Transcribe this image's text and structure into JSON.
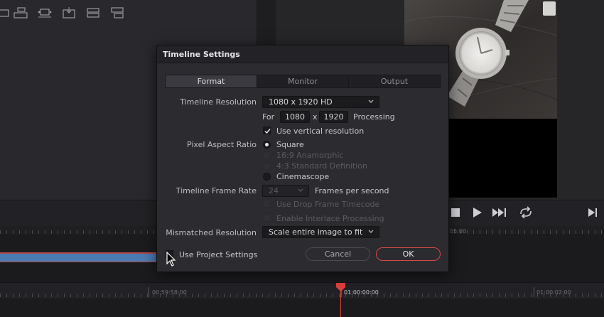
{
  "dialog": {
    "title": "Timeline Settings",
    "tabs": [
      "Format",
      "Monitor",
      "Output"
    ],
    "active_tab": "Format",
    "resolution": {
      "label": "Timeline Resolution",
      "value": "1080 x 1920 HD",
      "for_label": "For",
      "width": "1080",
      "x_label": "x",
      "height": "1920",
      "processing_label": "Processing",
      "vertical_label": "Use vertical resolution",
      "vertical_checked": true
    },
    "pixel_aspect": {
      "label": "Pixel Aspect Ratio",
      "options": [
        {
          "label": "Square",
          "selected": true,
          "enabled": true
        },
        {
          "label": "16:9 Anamorphic",
          "selected": false,
          "enabled": false
        },
        {
          "label": "4:3 Standard Definition",
          "selected": false,
          "enabled": false
        },
        {
          "label": "Cinemascope",
          "selected": false,
          "enabled": true
        }
      ]
    },
    "frame_rate": {
      "label": "Timeline Frame Rate",
      "value": "24",
      "suffix": "Frames per second",
      "drop_frame_label": "Use Drop Frame Timecode",
      "interlace_label": "Enable Interlace Processing"
    },
    "mismatched": {
      "label": "Mismatched Resolution",
      "value": "Scale entire image to fit"
    },
    "use_project_settings": {
      "label": "Use Project Settings",
      "checked": false
    },
    "buttons": {
      "cancel": "Cancel",
      "ok": "OK"
    }
  },
  "timeline": {
    "ruler_top_label": "05:00",
    "timecodes": [
      "00:59:58:00",
      "01:00:00:00",
      "01:00:02:00"
    ]
  },
  "colors": {
    "accent_red": "#e0413c",
    "clip_blue": "#4b7ab3",
    "dialog_bg": "#2b2b30"
  }
}
